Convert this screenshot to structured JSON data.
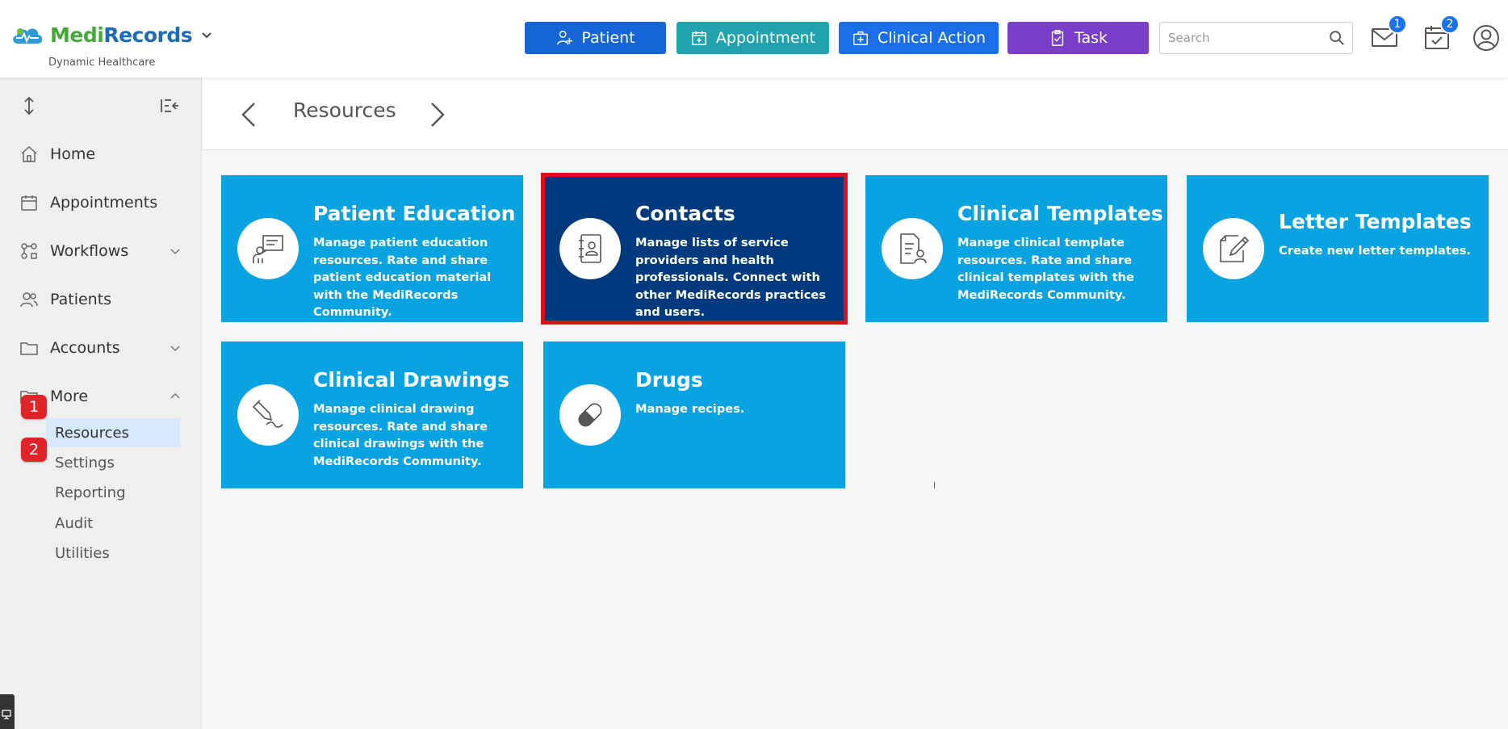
{
  "brand": {
    "name_part1": "Medi",
    "name_part2": "Records",
    "subtitle": "Dynamic Healthcare"
  },
  "topbar": {
    "buttons": [
      {
        "label": "Patient",
        "icon": "user-plus-icon",
        "color": "#1565d8"
      },
      {
        "label": "Appointment",
        "icon": "calendar-plus-icon",
        "color": "#20a3ae"
      },
      {
        "label": "Clinical Action",
        "icon": "medical-kit-icon",
        "color": "#1a6fe8"
      },
      {
        "label": "Task",
        "icon": "clipboard-check-icon",
        "color": "#7a3fc9"
      }
    ],
    "search": {
      "placeholder": "Search",
      "value": ""
    },
    "mail_badge": "1",
    "calendar_badge": "2"
  },
  "sidebar": {
    "items": [
      {
        "label": "Home",
        "icon": "home-icon"
      },
      {
        "label": "Appointments",
        "icon": "calendar-icon"
      },
      {
        "label": "Workflows",
        "icon": "workflow-icon"
      },
      {
        "label": "Patients",
        "icon": "users-icon"
      },
      {
        "label": "Accounts",
        "icon": "folder-icon"
      },
      {
        "label": "More",
        "icon": "folder-icon"
      }
    ],
    "more_subitems": [
      "Resources",
      "Settings",
      "Reporting",
      "Audit",
      "Utilities"
    ],
    "steps": [
      "1",
      "2"
    ]
  },
  "page": {
    "title": "Resources"
  },
  "cards": [
    {
      "title": "Patient Education",
      "description": "Manage patient education resources. Rate and share patient education material with the MediRecords Community.",
      "icon": "presentation-icon"
    },
    {
      "title": "Contacts",
      "description": "Manage lists of service providers and health professionals. Connect with other MediRecords practices and users.",
      "icon": "address-book-icon"
    },
    {
      "title": "Clinical Templates",
      "description": "Manage clinical template resources. Rate and share clinical templates with the MediRecords Community.",
      "icon": "document-user-icon"
    },
    {
      "title": "Letter Templates",
      "description": "Create new letter templates.",
      "icon": "edit-note-icon"
    },
    {
      "title": "Clinical Drawings",
      "description": "Manage clinical drawing resources. Rate and share clinical drawings with the MediRecords Community.",
      "icon": "pencil-drawing-icon"
    },
    {
      "title": "Drugs",
      "description": "Manage recipes.",
      "icon": "pill-icon"
    }
  ],
  "colors": {
    "card": "#0aa3e2",
    "card_selected": "#003a7e",
    "highlight": "#e0101a"
  }
}
